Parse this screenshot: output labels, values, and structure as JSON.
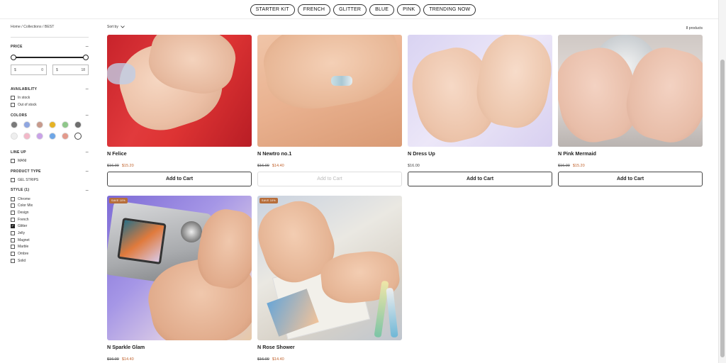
{
  "filter_pills": [
    "STARTER KIT",
    "FRENCH",
    "GLITTER",
    "BLUE",
    "PINK",
    "TRENDING NOW"
  ],
  "breadcrumb": "Home  /  Collections  /  BEST",
  "sort_label": "Sort by",
  "product_count": "8 products",
  "filters": {
    "price": {
      "title": "PRICE",
      "min_currency": "$",
      "min_value": "0",
      "max_currency": "$",
      "max_value": "18"
    },
    "availability": {
      "title": "AVAILABILITY",
      "options": [
        "In stock",
        "Out of stock"
      ]
    },
    "colors": {
      "title": "COLORS",
      "swatches": [
        "#7a7a7a",
        "#8fa6e0",
        "#c79a8c",
        "#e6b325",
        "#8fc78a",
        "#6e6e6e",
        "#eeeeee",
        "#f2b8c8",
        "#c9a2e8",
        "#6ea6e6",
        "#e39a8c",
        "#ffffff"
      ]
    },
    "line_up": {
      "title": "LINE UP",
      "options": [
        "MANI"
      ]
    },
    "product_type": {
      "title": "PRODUCT TYPE",
      "options": [
        "GEL STRIPS"
      ]
    },
    "style": {
      "title": "STYLE (1)",
      "options": [
        "Chrome",
        "Color Mix",
        "Design",
        "French",
        "Glitter",
        "Jelly",
        "Magnet",
        "Marble",
        "Ombre",
        "Solid"
      ],
      "checked": "Glitter"
    }
  },
  "products": [
    {
      "name": "N Felice",
      "old_price": "$16.00",
      "price": "$15.20",
      "cta": "Add to Cart",
      "enabled": true,
      "badge": "",
      "sale": true
    },
    {
      "name": "N Newtro no.1",
      "old_price": "$16.00",
      "price": "$14.40",
      "cta": "Add to Cart",
      "enabled": false,
      "badge": "",
      "sale": true
    },
    {
      "name": "N Dress Up",
      "old_price": "",
      "price": "$16.00",
      "cta": "Add to Cart",
      "enabled": true,
      "badge": "",
      "sale": false
    },
    {
      "name": "N Pink Mermaid",
      "old_price": "$16.00",
      "price": "$15.20",
      "cta": "Add to Cart",
      "enabled": true,
      "badge": "",
      "sale": true
    },
    {
      "name": "N Sparkle Glam",
      "old_price": "$16.00",
      "price": "$14.40",
      "cta": "",
      "enabled": true,
      "badge": "SAVE 10%",
      "sale": true
    },
    {
      "name": "N Rose Shower",
      "old_price": "$16.00",
      "price": "$14.40",
      "cta": "",
      "enabled": true,
      "badge": "SAVE 10%",
      "sale": true
    }
  ],
  "icons": {
    "sort": "chevron-down-icon",
    "collapse": "minus-icon"
  }
}
